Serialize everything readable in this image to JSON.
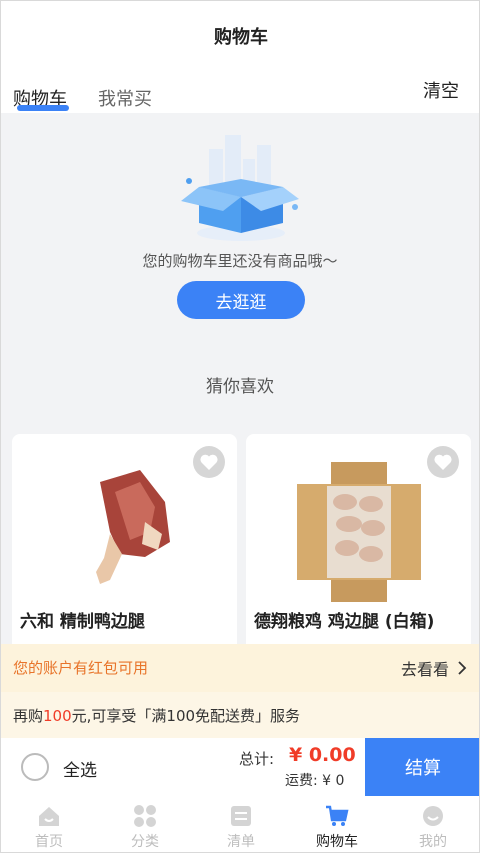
{
  "header": {
    "title": "购物车",
    "tabs": [
      {
        "label": "购物车",
        "active": true
      },
      {
        "label": "我常买",
        "active": false
      }
    ],
    "clear_label": "清空",
    "accent": "#3b82f6"
  },
  "empty_state": {
    "message": "您的购物车里还没有商品哦～",
    "button_label": "去逛逛"
  },
  "recommend": {
    "title": "猜你喜欢",
    "products": [
      {
        "name": "六和 精制鸭边腿",
        "icon": "duck-leg-image",
        "favorite_icon": "heart-icon"
      },
      {
        "name": "德翔粮鸡 鸡边腿 (白箱)",
        "icon": "chicken-box-image",
        "favorite_icon": "heart-icon"
      }
    ]
  },
  "redpacket": {
    "text": "您的账户有红包可用",
    "link_label": "去看看"
  },
  "promo": {
    "prefix": "再购",
    "amount": "100",
    "suffix": "元,可享受「满100免配送费」服务"
  },
  "checkout": {
    "select_all_label": "全选",
    "total_label": "总计:",
    "total_value": "¥ 0.00",
    "freight": "运费: ¥ 0",
    "pay_label": "结算"
  },
  "tabbar": [
    {
      "label": "首页",
      "icon": "home-icon",
      "active": false
    },
    {
      "label": "分类",
      "icon": "category-icon",
      "active": false
    },
    {
      "label": "清单",
      "icon": "list-icon",
      "active": false
    },
    {
      "label": "购物车",
      "icon": "cart-icon",
      "active": true
    },
    {
      "label": "我的",
      "icon": "profile-icon",
      "active": false
    }
  ]
}
